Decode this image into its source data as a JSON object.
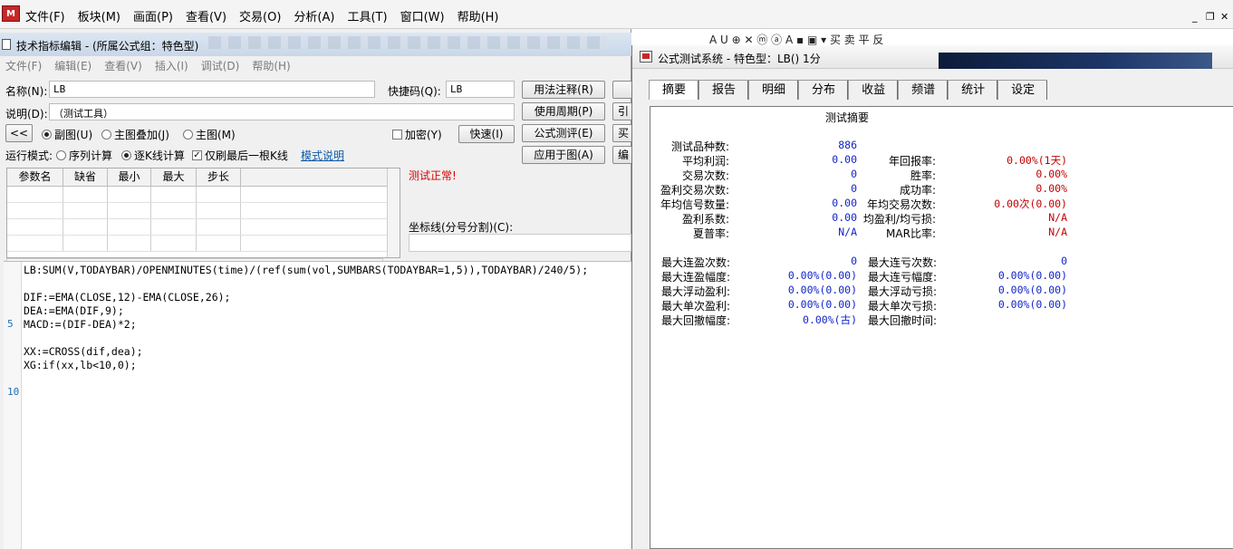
{
  "app": {
    "logo_text": "M",
    "menu": [
      "文件(F)",
      "板块(M)",
      "画面(P)",
      "查看(V)",
      "交易(O)",
      "分析(A)",
      "工具(T)",
      "窗口(W)",
      "帮助(H)"
    ],
    "window_controls": {
      "min": "_",
      "restore": "❐",
      "close": "✕"
    }
  },
  "editor": {
    "title": "技术指标编辑 - (所属公式组：特色型)",
    "menu": [
      "文件(F)",
      "编辑(E)",
      "查看(V)",
      "插入(I)",
      "调试(D)",
      "帮助(H)"
    ],
    "name_label": "名称(N):",
    "name_value": "LB",
    "shortcut_label": "快捷码(Q):",
    "shortcut_value": "LB",
    "desc_label": "说明(D):",
    "desc_value": "（测试工具）",
    "back_button": "<<",
    "chart_options": [
      "副图(U)",
      "主图叠加(J)",
      "主图(M)"
    ],
    "chart_selected": 0,
    "encrypt_label": "加密(Y)",
    "quick_button": "快速(I)",
    "run_mode_label": "运行模式:",
    "run_modes": [
      "序列计算",
      "逐K线计算"
    ],
    "run_mode_selected": 1,
    "refresh_last_label": "仅刷最后一根K线",
    "refresh_last_checked": true,
    "mode_help_link": "模式说明",
    "buttons": [
      "用法注释(R)",
      "使用周期(P)",
      "公式测评(E)",
      "应用于图(A)"
    ],
    "buttons_clipped": [
      "引",
      "买",
      "编"
    ],
    "status_text": "测试正常!",
    "param_headers": [
      "参数名",
      "缺省",
      "最小",
      "最大",
      "步长"
    ],
    "coord_label": "坐标线(分号分割)(C):",
    "gutter_numbers": [
      "5",
      "10"
    ],
    "code_lines": [
      "LB:SUM(V,TODAYBAR)/OPENMINUTES(time)/(ref(sum(vol,SUMBARS(TODAYBAR=1,5)),TODAYBAR)/240/5);",
      "",
      "DIF:=EMA(CLOSE,12)-EMA(CLOSE,26);",
      "DEA:=EMA(DIF,9);",
      "MACD:=(DIF-DEA)*2;",
      "",
      "XX:=CROSS(dif,dea);",
      "XG:if(xx,lb<10,0);"
    ]
  },
  "toolbar_strip": "A  U ⊕ ✕ ⓜ ⓐ A ▪ ▣ ▾  买 卖 平 反 _",
  "tester": {
    "title": "公式测试系统 - 特色型：LB() 1分",
    "tabs": [
      "摘要",
      "报告",
      "明细",
      "分布",
      "收益",
      "频谱",
      "统计",
      "设定"
    ],
    "active_tab": 0,
    "panel_title": "测试摘要",
    "rows": [
      {
        "l1": "测试品种数:",
        "v1": "886",
        "l2": "",
        "v2": ""
      },
      {
        "l1": "平均利润:",
        "v1": "0.00",
        "l2": "年回报率:",
        "v2": "0.00%(1天)"
      },
      {
        "l1": "交易次数:",
        "v1": "0",
        "l2": "胜率:",
        "v2": "0.00%"
      },
      {
        "l1": "盈利交易次数:",
        "v1": "0",
        "l2": "成功率:",
        "v2": "0.00%"
      },
      {
        "l1": "年均信号数量:",
        "v1": "0.00",
        "l2": "年均交易次数:",
        "v2": "0.00次(0.00)"
      },
      {
        "l1": "盈利系数:",
        "v1": "0.00",
        "l2": "均盈利/均亏损:",
        "v2": "N/A"
      },
      {
        "l1": "夏普率:",
        "v1": "N/A",
        "l2": "MAR比率:",
        "v2": "N/A"
      }
    ],
    "rows2": [
      {
        "l1": "最大连盈次数:",
        "v1": "0",
        "l2": "最大连亏次数:",
        "v2": "0"
      },
      {
        "l1": "最大连盈幅度:",
        "v1": "0.00%(0.00)",
        "l2": "最大连亏幅度:",
        "v2": "0.00%(0.00)"
      },
      {
        "l1": "最大浮动盈利:",
        "v1": "0.00%(0.00)",
        "l2": "最大浮动亏损:",
        "v2": "0.00%(0.00)"
      },
      {
        "l1": "最大单次盈利:",
        "v1": "0.00%(0.00)",
        "l2": "最大单次亏损:",
        "v2": "0.00%(0.00)"
      },
      {
        "l1": "最大回撤幅度:",
        "v1": "0.00%(古)",
        "l2": "最大回撤时间:",
        "v2": ""
      }
    ]
  }
}
